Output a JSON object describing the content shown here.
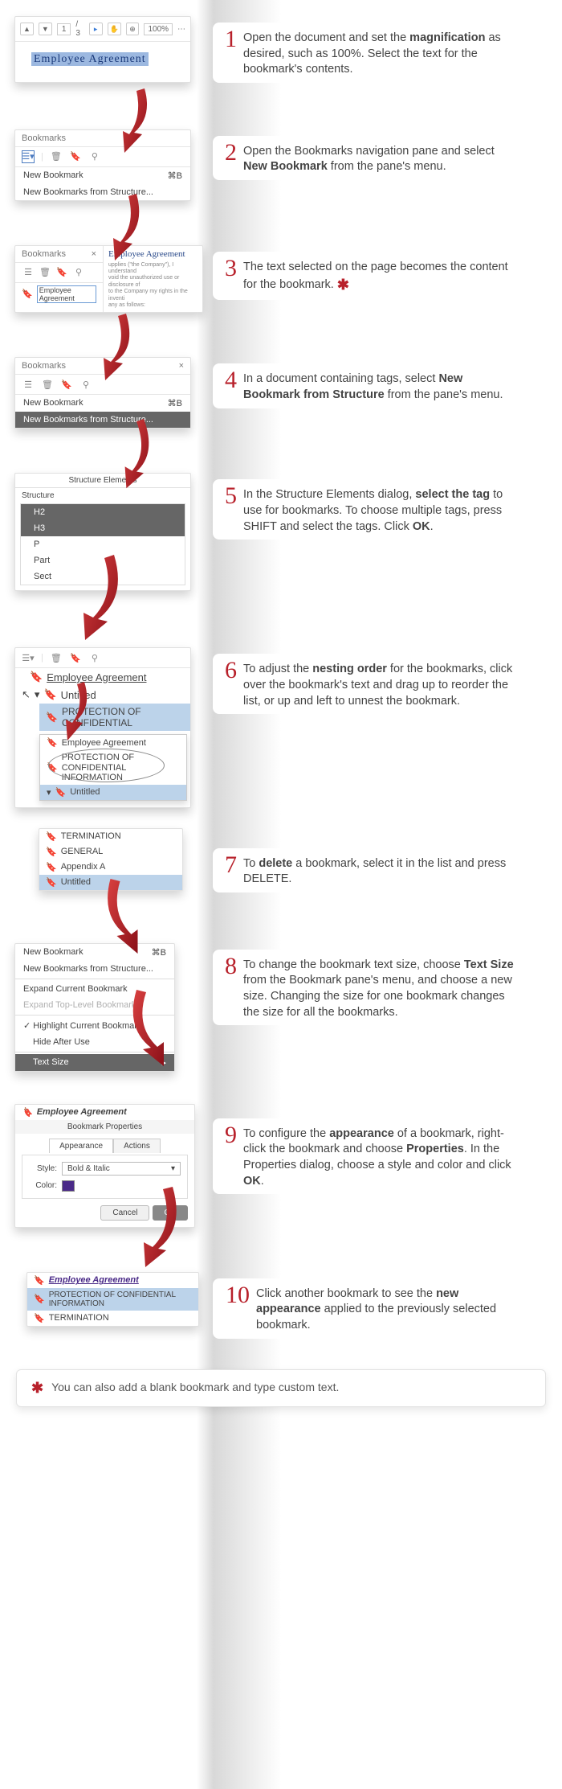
{
  "zoom": "100%",
  "pageField": "1",
  "pageTotal": "/ 3",
  "docSelectedText": "Employee  Agreement",
  "bookmarksTitle": "Bookmarks",
  "menu": {
    "newBookmark": "New Bookmark",
    "newBookmarkShort": "⌘B",
    "newFromStruct": "New Bookmarks from Structure...",
    "expandCurrent": "Expand Current Bookmark",
    "expandTop": "Expand Top-Level Bookmarks",
    "hlCurrent": "Highlight Current Bookmark",
    "hideAfter": "Hide After Use",
    "textSize": "Text Size"
  },
  "bmEmpAgreement": "Employee Agreement",
  "docBody": "upplies (\"the Company\"), I understand\nvoid the unauthorized use or disclosure of\nto the Company my rights in the inventi\nany as follows:",
  "structDialogTitle": "Structure Elements",
  "structLabel": "Structure",
  "tags": {
    "h2": "H2",
    "h3": "H3",
    "p": "P",
    "part": "Part",
    "sect": "Sect"
  },
  "bm6": {
    "emp": "Employee Agreement",
    "untitled": "Untitled",
    "prot": "PROTECTION OF CONFIDENTIAL",
    "prot2": "PROTECTION OF\nCONFIDENTIAL\nINFORMATION"
  },
  "bm7": {
    "term": "TERMINATION",
    "gen": "GENERAL",
    "appA": "Appendix A",
    "untitled": "Untitled"
  },
  "props": {
    "title": "Bookmark Properties",
    "tabApp": "Appearance",
    "tabAct": "Actions",
    "styleLabel": "Style:",
    "styleVal": "Bold & Italic",
    "colorLabel": "Color:",
    "cancel": "Cancel",
    "ok": "OK"
  },
  "bm10": {
    "emp": "Employee Agreement",
    "prot": "PROTECTION OF CONFIDENTIAL INFORMATION",
    "term": "TERMINATION"
  },
  "steps": {
    "s1a": "Open the document and set the ",
    "s1b": "magnification",
    "s1c": " as desired, such as 100%. Select the text for the bookmark's contents.",
    "s2a": "Open the Bookmarks navigation pane and select ",
    "s2b": "New Bookmark",
    "s2c": " from the pane's menu.",
    "s3": "The text selected on the page becomes the content for the bookmark. ",
    "s4a": "In a document containing tags, select ",
    "s4b": "New Bookmark from Structure",
    "s4c": " from the pane's menu.",
    "s5a": "In the Structure Elements dialog, ",
    "s5b": "select the tag",
    "s5c": " to use for bookmarks. To choose multiple tags, press SHIFT and select the tags. Click ",
    "s5d": "OK",
    "s5e": ".",
    "s6a": "To adjust the ",
    "s6b": "nesting order",
    "s6c": " for the bookmarks, click over the bookmark's text and drag up to reorder the list, or up and left to unnest the bookmark.",
    "s7a": "To ",
    "s7b": "delete",
    "s7c": " a bookmark, select it in the list and press DELETE.",
    "s8a": "To change the bookmark text size, choose ",
    "s8b": "Text Size",
    "s8c": " from the Bookmark pane's menu, and choose a new size. Changing the size for one bookmark changes the size for all the bookmarks.",
    "s9a": "To configure the ",
    "s9b": "appearance",
    "s9c": " of a bookmark, right-click the bookmark and choose ",
    "s9d": "Properties",
    "s9e": ". In the Properties dialog, choose a style and color and click ",
    "s9f": "OK",
    "s9g": ".",
    "s10a": "Click another bookmark to see the ",
    "s10b": "new appearance",
    "s10c": " applied to the previously selected bookmark."
  },
  "footnote": "You can also add a blank bookmark and type custom text."
}
